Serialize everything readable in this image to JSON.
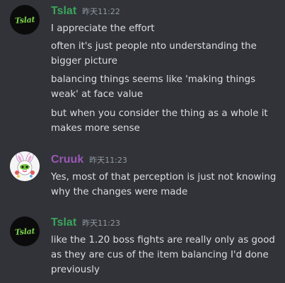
{
  "colors": {
    "background": "#313338",
    "text": "#dbdee1",
    "timestamp": "#949ba4",
    "tslat_name": "#3ba55c",
    "cruuk_name": "#9b59b6"
  },
  "messages": [
    {
      "author": "Tslat",
      "avatar_text": "Tslat",
      "timestamp": "昨天11:22",
      "lines": [
        "I appreciate the effort",
        "often it's just people nto understanding the bigger picture",
        "balancing things seems like 'making things weak' at face value",
        "but when you consider the thing as a whole it makes more sense"
      ]
    },
    {
      "author": "Cruuk",
      "avatar_icon": "rabbit-mascot-icon",
      "timestamp": "昨天11:23",
      "lines": [
        "Yes, most of that perception is just not knowing why the changes were made"
      ]
    },
    {
      "author": "Tslat",
      "avatar_text": "Tslat",
      "timestamp": "昨天11:23",
      "lines": [
        "like the 1.20 boss fights are really only as good as they are cus of the item balancing I'd done previously"
      ]
    }
  ]
}
